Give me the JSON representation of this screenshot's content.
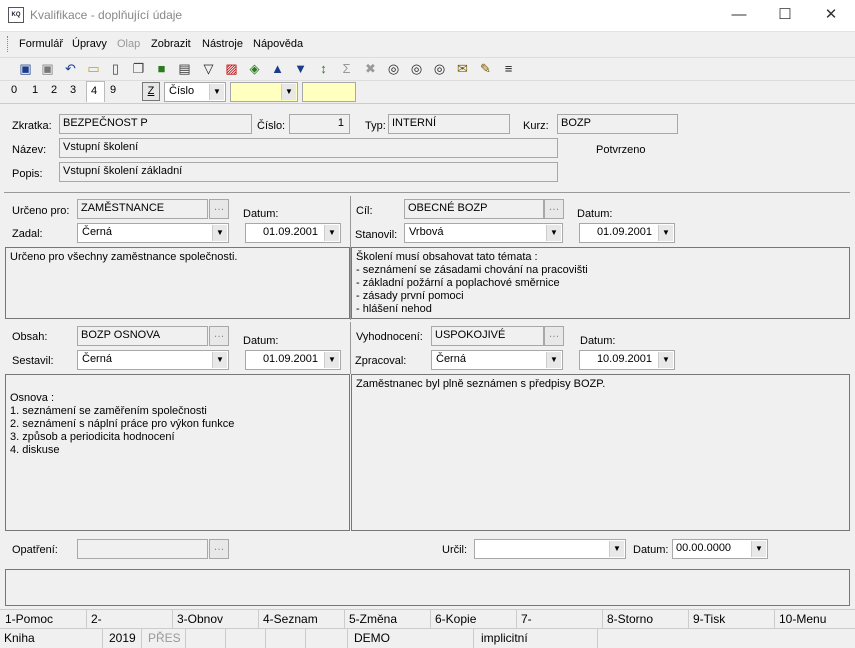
{
  "window": {
    "title": "Kvalifikace - doplňující údaje",
    "icon_text": "KQ"
  },
  "menu": [
    "Formulář",
    "Úpravy",
    "Olap",
    "Zobrazit",
    "Nástroje",
    "Nápověda"
  ],
  "toolbar_icons": [
    "save-icon",
    "save-as-icon",
    "undo-icon",
    "open-folder-icon",
    "new-document-icon",
    "copy-icon",
    "lock-icon",
    "book-icon",
    "filter-icon",
    "delete-filter-icon",
    "stack-icon",
    "arrow-up-icon",
    "arrow-down-icon",
    "sort-icon",
    "sum-icon",
    "clear-icon",
    "binoculars-icon",
    "find-next-icon",
    "find-prev-icon",
    "mail-icon",
    "notes-icon",
    "hamburger-icon"
  ],
  "tabs": {
    "items": [
      "0",
      "1",
      "2",
      "3",
      "4",
      "9"
    ],
    "active": "4",
    "z_button": "Z",
    "sort_select": "Číslo",
    "filter_value": "",
    "search_value": ""
  },
  "header": {
    "zkratka_label": "Zkratka:",
    "zkratka": "BEZPEČNOST P",
    "cislo_label": "Číslo:",
    "cislo": "1",
    "typ_label": "Typ:",
    "typ": "INTERNÍ",
    "kurz_label": "Kurz:",
    "kurz": "BOZP",
    "nazev_label": "Název:",
    "nazev": "Vstupní školení",
    "popis_label": "Popis:",
    "popis": "Vstupní školení základní",
    "potvrzeno": "Potvrzeno"
  },
  "section1": {
    "left": {
      "label1": "Určeno pro:",
      "value1": "ZAMĚSTNANCE",
      "label2": "Zadal:",
      "value2": "Černá",
      "datum_label": "Datum:",
      "datum": "01.09.2001",
      "memo": [
        "Určeno pro všechny zaměstnance společnosti."
      ]
    },
    "right": {
      "label1": "Cíl:",
      "value1": "OBECNÉ BOZP",
      "label2": "Stanovil:",
      "value2": "Vrbová",
      "datum_label": "Datum:",
      "datum": "01.09.2001",
      "memo": [
        "Školení musí obsahovat tato témata :",
        "- seznámení se zásadami chování na pracovišti",
        "- základní požární a poplachové směrnice",
        "- zásady první pomoci",
        "- hlášení nehod"
      ]
    }
  },
  "section2": {
    "left": {
      "label1": "Obsah:",
      "value1": "BOZP OSNOVA",
      "label2": "Sestavil:",
      "value2": "Černá",
      "datum_label": "Datum:",
      "datum": "01.09.2001",
      "memo": [
        "Osnova :",
        "1. seznámení se zaměřením společnosti",
        "2. seznámení s náplní práce pro výkon funkce",
        "3. způsob a periodicita hodnocení",
        "4. diskuse"
      ]
    },
    "right": {
      "label1": "Vyhodnocení:",
      "value1": "USPOKOJIVÉ",
      "label2": "Zpracoval:",
      "value2": "Černá",
      "datum_label": "Datum:",
      "datum": "10.09.2001",
      "memo": [
        "Zaměstnanec byl plně seznámen s předpisy BOZP."
      ]
    }
  },
  "footer_fields": {
    "opatreni_label": "Opatření:",
    "opatreni": "",
    "urcil_label": "Určil:",
    "urcil": "",
    "datum_label": "Datum:",
    "datum": "00.00.0000"
  },
  "fkeys": [
    "1-Pomoc",
    "2-",
    "3-Obnov",
    "4-Seznam",
    "5-Změna",
    "6-Kopie",
    "7-",
    "8-Storno",
    "9-Tisk",
    "10-Menu"
  ],
  "status": {
    "module": "Kniha",
    "year": "2019",
    "mode": "PŘES",
    "db": "DEMO",
    "profile": "implicitní"
  }
}
